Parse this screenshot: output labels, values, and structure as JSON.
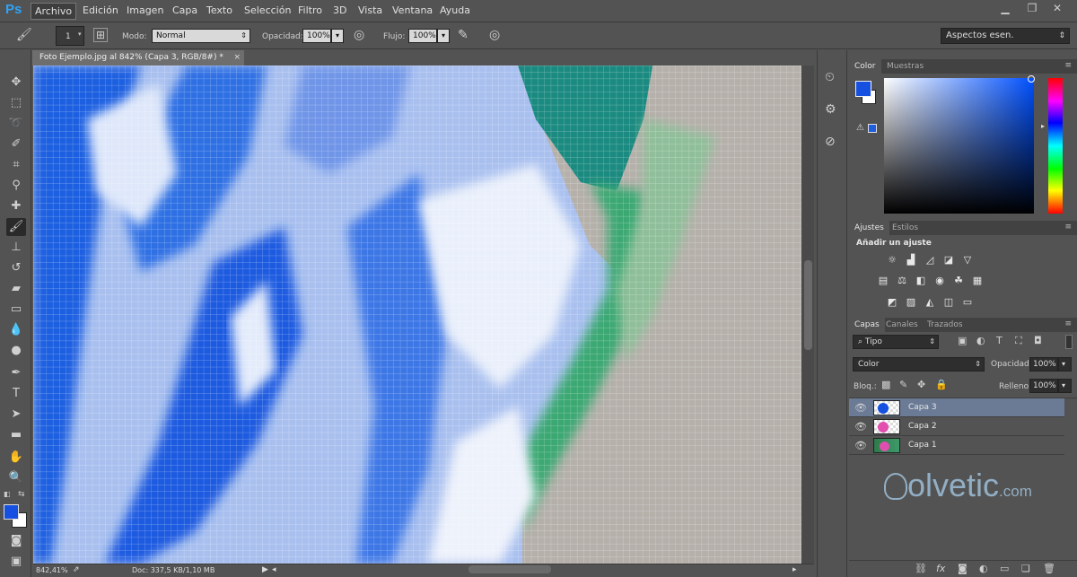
{
  "app": {
    "logo": "Ps"
  },
  "menu": [
    "Archivo",
    "Edición",
    "Imagen",
    "Capa",
    "Texto",
    "Selección",
    "Filtro",
    "3D",
    "Vista",
    "Ventana",
    "Ayuda"
  ],
  "window_controls": {
    "minimize": "▁",
    "restore": "❐",
    "close": "✕"
  },
  "options": {
    "brush_size": "1",
    "mode_label": "Modo:",
    "mode_value": "Normal",
    "opacity_label": "Opacidad:",
    "opacity_value": "100%",
    "flow_label": "Flujo:",
    "flow_value": "100%",
    "workspace": "Aspectos esen."
  },
  "document": {
    "tab_title": "Foto Ejemplo.jpg al 842% (Capa 3, RGB/8#) *",
    "close": "×"
  },
  "status": {
    "zoom": "842,41%",
    "doc": "Doc: 337,5 KB/1,10 MB"
  },
  "color_panel": {
    "tabs": [
      "Color",
      "Muestras"
    ],
    "foreground": "#1550e0",
    "background": "#ffffff"
  },
  "adjust_panel": {
    "tabs": [
      "Ajustes",
      "Estilos"
    ],
    "heading": "Añadir un ajuste"
  },
  "layers_panel": {
    "tabs": [
      "Capas",
      "Canales",
      "Trazados"
    ],
    "filter": "Tipo",
    "blend_mode": "Color",
    "opacity_label": "Opacidad:",
    "opacity_value": "100%",
    "lock_label": "Bloq.:",
    "fill_label": "Relleno:",
    "fill_value": "100%",
    "layers": [
      {
        "name": "Capa 3",
        "selected": true
      },
      {
        "name": "Capa 2",
        "selected": false
      },
      {
        "name": "Capa 1",
        "selected": false
      }
    ]
  },
  "watermark": {
    "brand": "olvetic",
    "suffix": ".com"
  }
}
